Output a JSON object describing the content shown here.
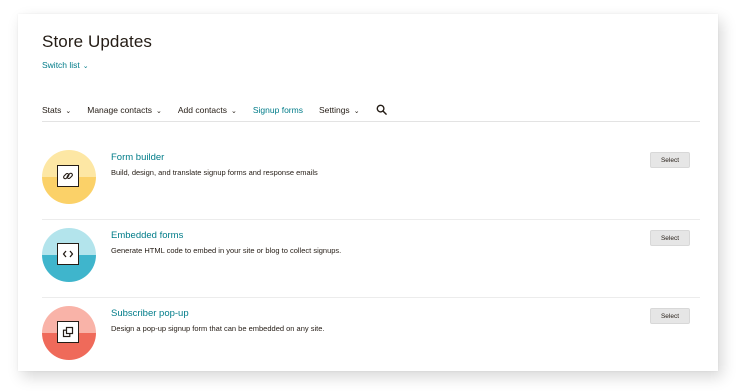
{
  "page": {
    "title": "Store Updates",
    "switch_list": "Switch list"
  },
  "nav": {
    "items": [
      {
        "label": "Stats",
        "dropdown": true
      },
      {
        "label": "Manage contacts",
        "dropdown": true
      },
      {
        "label": "Add contacts",
        "dropdown": true
      },
      {
        "label": "Signup forms",
        "dropdown": false,
        "active": true
      },
      {
        "label": "Settings",
        "dropdown": true
      }
    ],
    "search_icon": "search-icon"
  },
  "options": [
    {
      "title": "Form builder",
      "description": "Build, design, and translate signup forms and response emails",
      "button": "Select",
      "icon": "link-icon",
      "color_top": "#fde7a4",
      "color_bottom": "#fbd168"
    },
    {
      "title": "Embedded forms",
      "description": "Generate HTML code to embed in your site or blog to collect signups.",
      "button": "Select",
      "icon": "code-icon",
      "color_top": "#b3e4ec",
      "color_bottom": "#3fb5cc"
    },
    {
      "title": "Subscriber pop-up",
      "description": "Design a pop-up signup form that can be embedded on any site.",
      "button": "Select",
      "icon": "popup-icon",
      "color_top": "#f9b3a8",
      "color_bottom": "#ef6a5a"
    }
  ],
  "colors": {
    "accent": "#007c89",
    "text": "#241c15",
    "button_bg": "#e6e6e6"
  }
}
